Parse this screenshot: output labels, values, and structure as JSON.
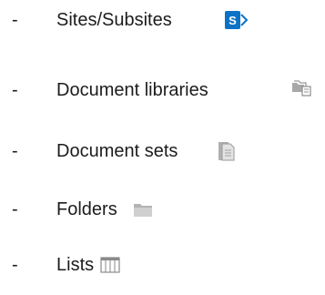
{
  "items": [
    {
      "bullet": "-",
      "label": "Sites/Subsites",
      "icon": "sharepoint-site-icon"
    },
    {
      "bullet": "-",
      "label": "Document libraries",
      "icon": "document-library-icon"
    },
    {
      "bullet": "-",
      "label": "Document sets",
      "icon": "document-set-icon"
    },
    {
      "bullet": "-",
      "label": "Folders",
      "icon": "folder-icon"
    },
    {
      "bullet": "-",
      "label": "Lists",
      "icon": "list-icon"
    }
  ],
  "colors": {
    "text": "#1c1c1c",
    "sharepoint_blue": "#0b72c6",
    "icon_gray": "#9a9a9a"
  },
  "sharepoint_icon_letter": "S"
}
